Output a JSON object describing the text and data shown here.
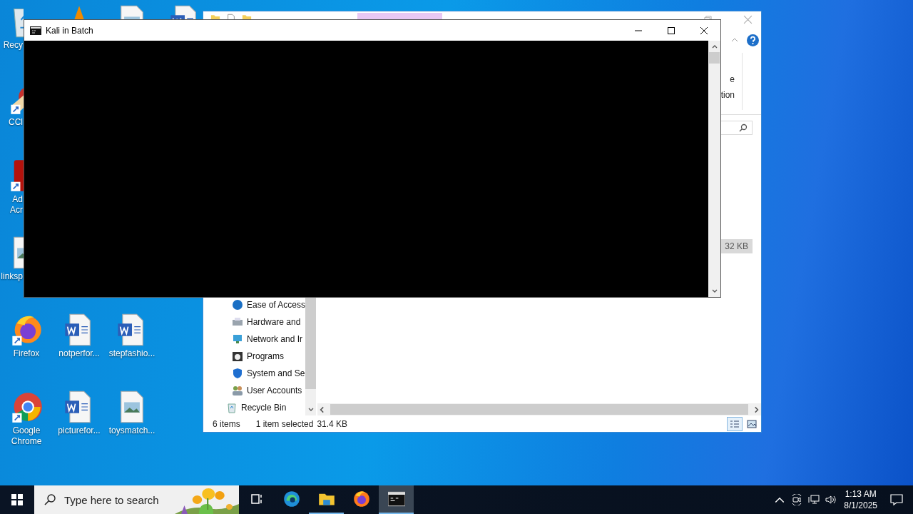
{
  "desktop_icons": [
    {
      "kind": "recycle-bin",
      "lines": [
        "Recy"
      ]
    },
    {
      "kind": "ccleaner",
      "lines": [
        "CCl"
      ]
    },
    {
      "kind": "acrobat",
      "lines": [
        "Ad",
        "Acr"
      ]
    },
    {
      "kind": "image-file",
      "lines": [
        "linksp"
      ]
    },
    {
      "kind": "firefox",
      "lines": [
        "Firefox"
      ]
    },
    {
      "kind": "chrome",
      "lines": [
        "Google",
        "Chrome"
      ]
    },
    {
      "kind": "cone"
    },
    {
      "kind": "word",
      "lines": [
        "notperfor..."
      ]
    },
    {
      "kind": "word",
      "lines": [
        "picturefor..."
      ]
    },
    {
      "kind": "image-file"
    },
    {
      "kind": "word",
      "lines": [
        "stepfashio..."
      ]
    },
    {
      "kind": "image-file",
      "lines": [
        "toysmatch..."
      ]
    },
    {
      "kind": "word"
    }
  ],
  "explorer": {
    "ribbon_text": [
      "e",
      "tion"
    ],
    "nav_pane": {
      "sub_items": [
        {
          "label": "Ease of Access",
          "kind": "globe"
        },
        {
          "label": "Hardware and",
          "kind": "printer"
        },
        {
          "label": "Network and Ir",
          "kind": "monitor"
        },
        {
          "label": "Programs",
          "kind": "disc"
        },
        {
          "label": "System and Se",
          "kind": "shield"
        },
        {
          "label": "User Accounts",
          "kind": "people"
        }
      ],
      "items": [
        {
          "label": "Recycle Bin",
          "kind": "recycle"
        }
      ]
    },
    "file_rows": [
      {
        "size": "32 KB",
        "selected": true
      }
    ],
    "status_bar": {
      "count": "6 items",
      "selection": "1 item selected",
      "size": "31.4 KB"
    },
    "views": [
      {
        "kind": "details",
        "selected": true
      },
      {
        "kind": "large",
        "selected": false
      }
    ]
  },
  "console": {
    "title": "Kali in Batch"
  },
  "taskbar": {
    "search": {
      "placeholder": "Type here to search"
    },
    "apps": [
      {
        "kind": "task-view",
        "open": false,
        "active": false
      },
      {
        "kind": "edge",
        "open": false,
        "active": false
      },
      {
        "kind": "folder",
        "open": true,
        "active": false
      },
      {
        "kind": "firefox",
        "open": false,
        "active": false
      },
      {
        "kind": "terminal",
        "open": true,
        "active": true
      }
    ],
    "time": "1:13 AM",
    "date": "8/1/2025"
  }
}
